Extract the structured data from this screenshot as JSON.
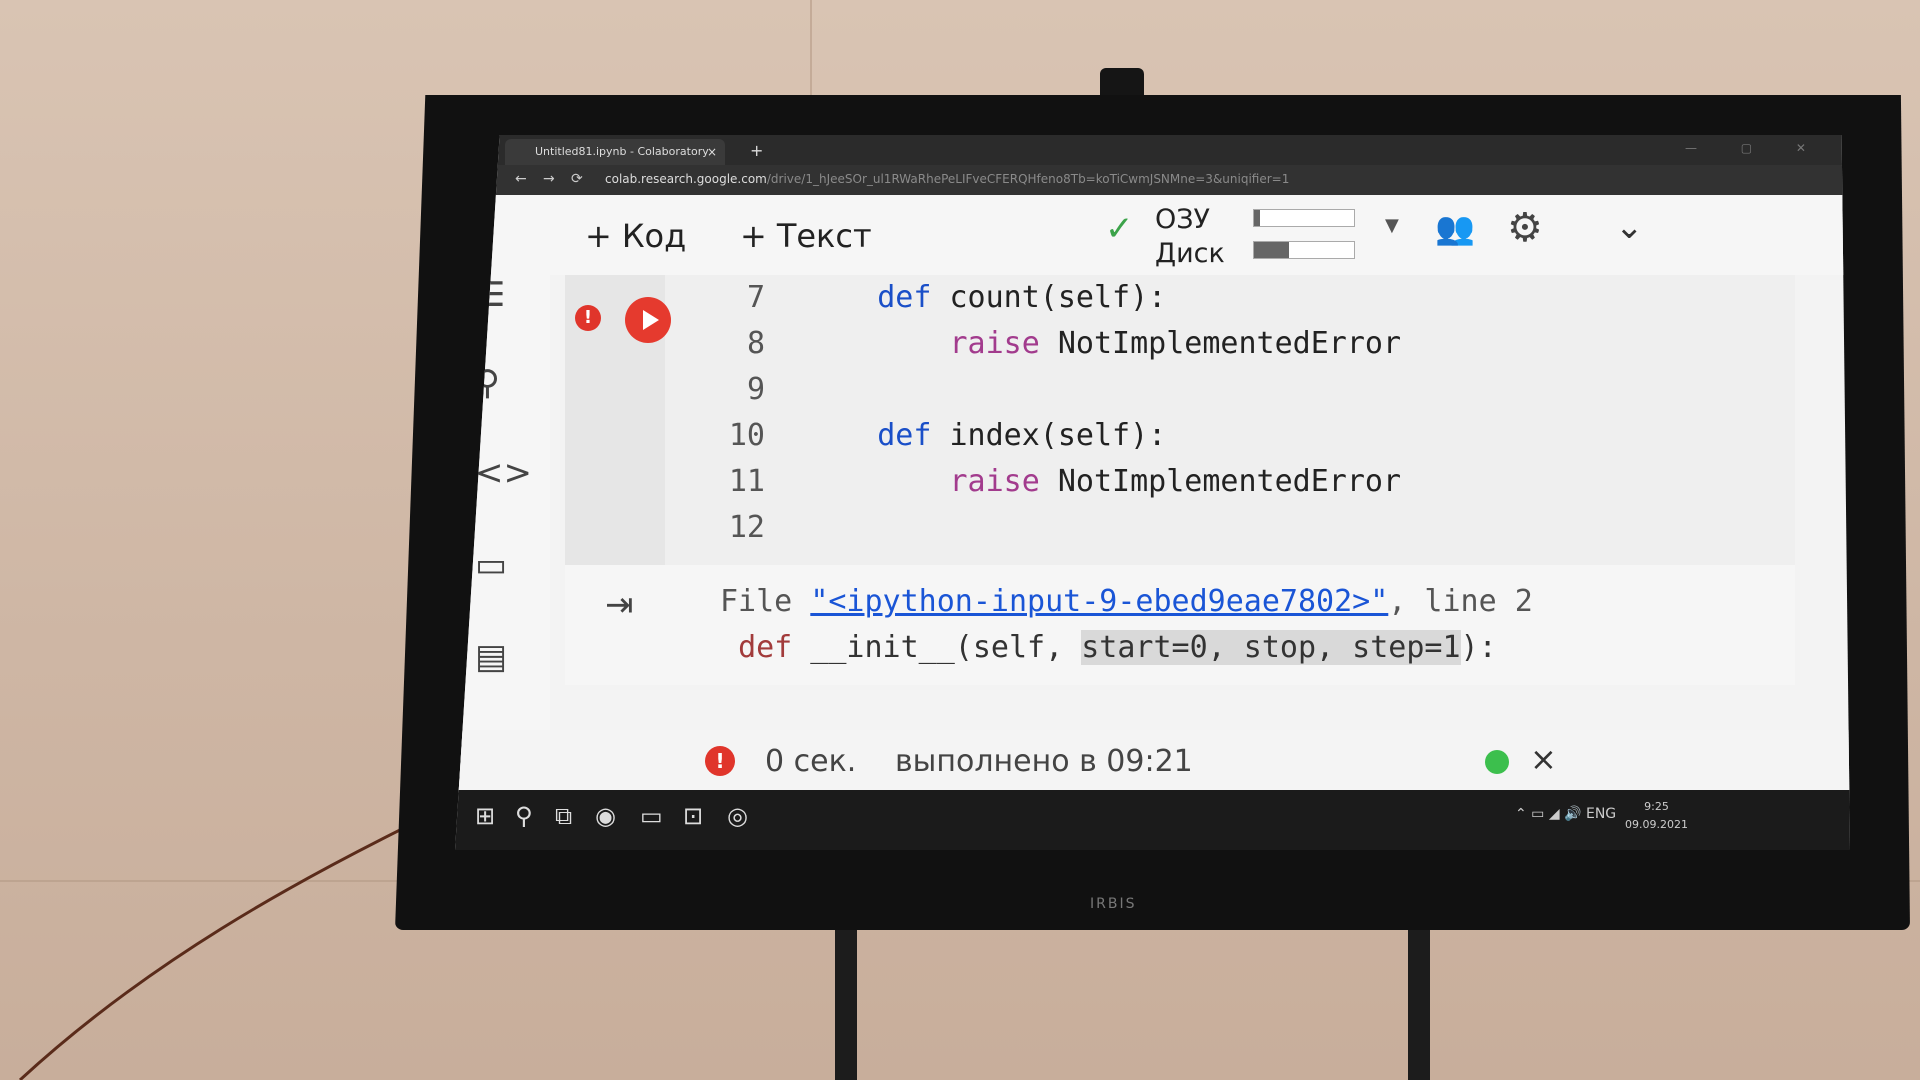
{
  "browser": {
    "tab_title": "Untitled81.ipynb - Colaboratory",
    "tab_close": "×",
    "new_tab": "+",
    "url_host": "colab.research.google.com",
    "url_path": "/drive/1_hJeeSOr_ul1RWaRhePeLIFveCFERQHfeno8Tb=koTiCwmJSNMne=3&uniqifier=1"
  },
  "toolbar": {
    "add_code": "Код",
    "add_text": "Текст",
    "ram_label": "ОЗУ",
    "disk_label": "Диск",
    "ram_usage": 0.06,
    "disk_usage": 0.35
  },
  "cell": {
    "lines": [
      {
        "num": "7",
        "kw": "def",
        "rest": " count(self):",
        "indent": "    "
      },
      {
        "num": "8",
        "kw": "raise",
        "rest": " NotImplementedError",
        "indent": "        "
      },
      {
        "num": "9",
        "kw": "",
        "rest": "",
        "indent": ""
      },
      {
        "num": "10",
        "kw": "def",
        "rest": " index(self):",
        "indent": "    "
      },
      {
        "num": "11",
        "kw": "raise",
        "rest": " NotImplementedError",
        "indent": "        "
      },
      {
        "num": "12",
        "kw": "",
        "rest": "",
        "indent": ""
      }
    ],
    "error_badge": "!"
  },
  "output": {
    "file_prefix": "File ",
    "file_link": "\"<ipython-input-9-ebed9eae7802>\"",
    "file_suffix": ", line 2",
    "def_kw": "def",
    "def_mid": " __init__(self, ",
    "def_hl": "start=0, stop, step=1",
    "def_end": "):"
  },
  "status": {
    "badge": "!",
    "duration": "0 сек.",
    "completed": "выполнено в 09:21",
    "close": "×"
  },
  "taskbar": {
    "lang": "ENG",
    "time": "9:25",
    "date": "09.09.2021"
  },
  "device": {
    "brand": "IRBIS"
  }
}
